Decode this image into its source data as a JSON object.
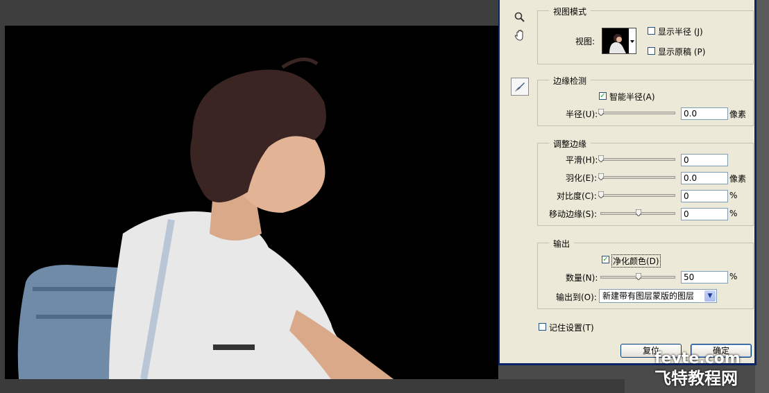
{
  "dialog": {
    "view_mode": {
      "title": "视图模式",
      "view_label": "视图:",
      "show_radius_label": "显示半径 (J)",
      "show_radius_checked": false,
      "show_original_label": "显示原稿 (P)",
      "show_original_checked": false
    },
    "edge_detection": {
      "title": "边缘检测",
      "smart_radius_label": "智能半径(A)",
      "smart_radius_checked": true,
      "radius_label": "半径(U):",
      "radius_value": "0.0",
      "radius_unit": "像素",
      "radius_slider": 0
    },
    "adjust_edge": {
      "title": "调整边缘",
      "smooth_label": "平滑(H):",
      "smooth_value": "0",
      "smooth_slider": 0,
      "feather_label": "羽化(E):",
      "feather_value": "0.0",
      "feather_unit": "像素",
      "feather_slider": 0,
      "contrast_label": "对比度(C):",
      "contrast_value": "0",
      "contrast_unit": "%",
      "contrast_slider": 0,
      "shift_edge_label": "移动边缘(S):",
      "shift_edge_value": "0",
      "shift_edge_unit": "%",
      "shift_edge_slider": 0.5
    },
    "output": {
      "title": "输出",
      "decontaminate_label": "净化颜色(D)",
      "decontaminate_checked": true,
      "amount_label": "数量(N):",
      "amount_value": "50",
      "amount_unit": "%",
      "amount_slider": 0.5,
      "output_to_label": "输出到(O):",
      "output_to_value": "新建带有图层蒙版的图层"
    },
    "remember_label": "记住设置(T)",
    "remember_checked": false,
    "reset_label": "复位",
    "ok_label": "确定"
  },
  "watermark": {
    "line1": "fevte.com",
    "line2": "飞特教程网"
  },
  "colors": {
    "dialog_bg": "#ece9d8",
    "window_border": "#0a246a",
    "canvas_bg": "#000000",
    "workspace_bg": "#3d3d3d",
    "check_green": "#21a121"
  },
  "icons": {
    "zoom": "zoom-icon",
    "hand": "hand-icon",
    "refine_brush": "refine-radius-brush-icon"
  }
}
